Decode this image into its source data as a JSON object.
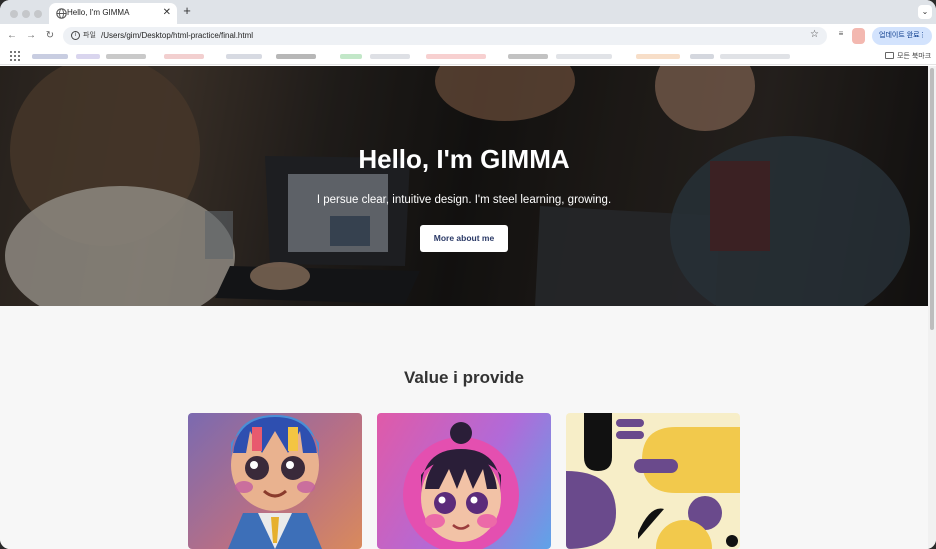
{
  "browser": {
    "tab_title": "Hello, I'm GIMMA",
    "new_tab_label": "+",
    "tab_close_label": "✕",
    "url_scheme_chip": "파일",
    "url": "/Users/gim/Desktop/html-practice/final.html",
    "update_button_label": "업데이트 완료",
    "all_bookmarks_label": "모든 북마크",
    "icons": [
      "back-icon",
      "forward-icon",
      "reload-icon",
      "info-icon",
      "star-icon",
      "globe-icon",
      "apps-grid-icon",
      "folder-icon"
    ]
  },
  "hero": {
    "title": "Hello, I'm GIMMA",
    "subtitle": "I persue clear, intuitive design. I'm steel learning, growing.",
    "button_label": "More about me"
  },
  "values": {
    "title": "Value i provide",
    "cards": [
      {
        "label": "3d-boy-character-card"
      },
      {
        "label": "3d-girl-character-card"
      },
      {
        "label": "abstract-shapes-card"
      }
    ]
  },
  "colors": {
    "hero_button_text": "#2b3a67",
    "update_button_bg": "#d3e3fd",
    "page_bg": "#f7f7f7"
  }
}
